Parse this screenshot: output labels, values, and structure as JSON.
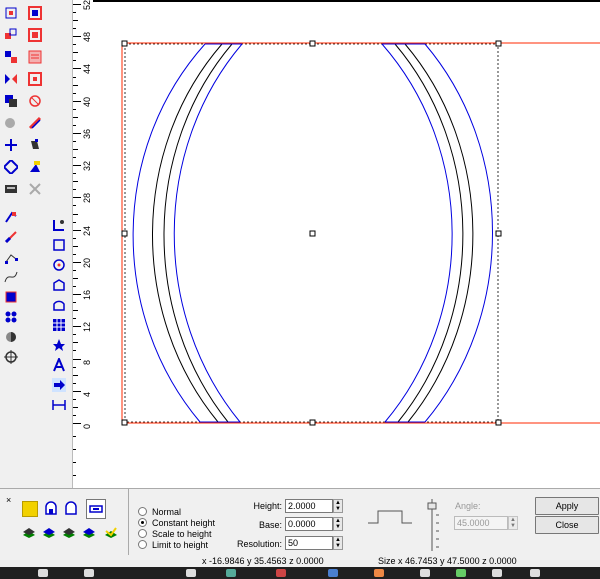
{
  "ruler": {
    "labels": [
      "52",
      "48",
      "44",
      "40",
      "36",
      "32",
      "28",
      "24",
      "20",
      "16",
      "12",
      "8",
      "4",
      "0"
    ]
  },
  "options": {
    "height_mode": [
      {
        "label": "Normal",
        "selected": false
      },
      {
        "label": "Constant height",
        "selected": true
      },
      {
        "label": "Scale to height",
        "selected": false
      },
      {
        "label": "Limit to height",
        "selected": false
      }
    ]
  },
  "fields": {
    "height": {
      "label": "Height:",
      "value": "2.0000"
    },
    "base": {
      "label": "Base:",
      "value": "0.0000"
    },
    "resolution": {
      "label": "Resolution:",
      "value": "50"
    },
    "angle": {
      "label": "Angle:",
      "value": "45.0000"
    }
  },
  "buttons": {
    "apply": "Apply",
    "close": "Close"
  },
  "status": {
    "cursor": "x -16.9846 y 35.4563 z 0.0000",
    "size": "Size x 46.7453 y 47.5000 z 0.0000"
  },
  "colors": {
    "selection": "#ff2a00",
    "vector_blue": "#0000e0",
    "vector_black": "#000000",
    "swatch_yellow": "#f2d100"
  }
}
